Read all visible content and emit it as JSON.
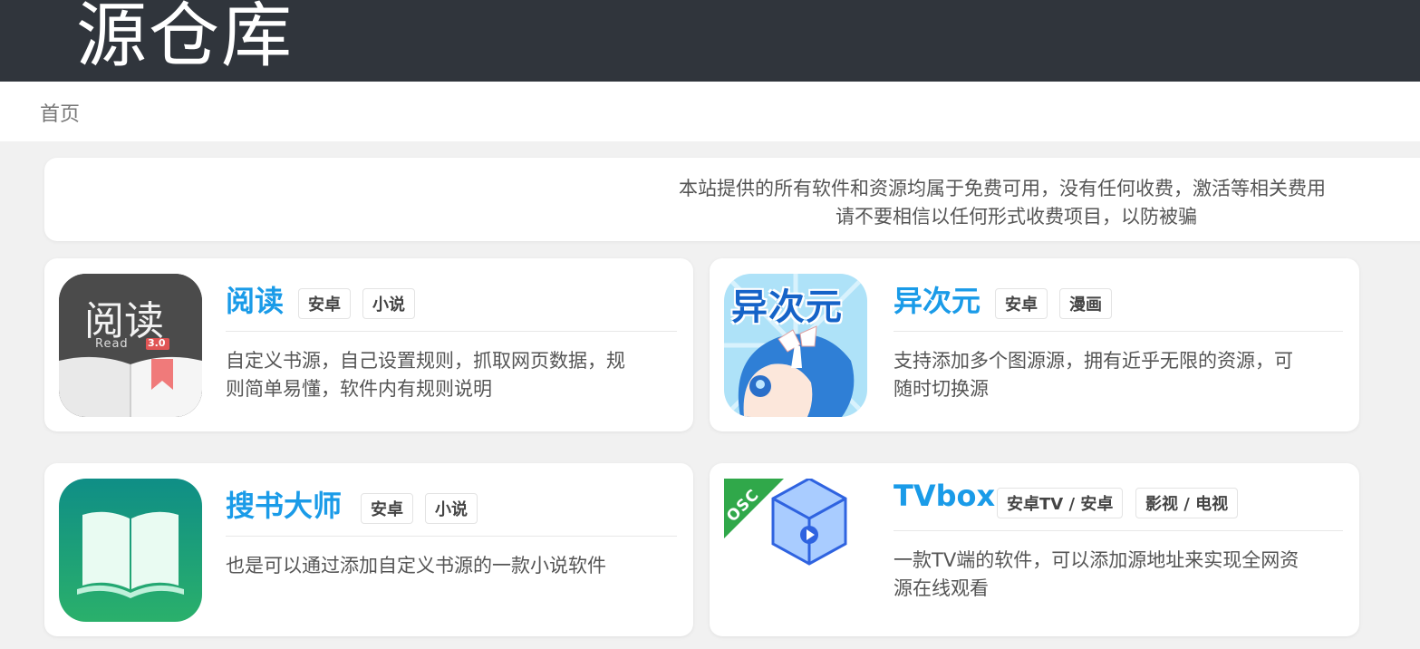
{
  "header": {
    "site_title": "源仓库"
  },
  "nav": {
    "home": "首页"
  },
  "notice": {
    "line1": "本站提供的所有软件和资源均属于免费可用，没有任何收费，激活等相关费用",
    "line2": "请不要相信以任何形式收费项目，以防被骗"
  },
  "cards": [
    {
      "title": "阅读",
      "tags": [
        "安卓",
        "小说"
      ],
      "desc_line1": "自定义书源，自己设置规则，抓取网页数据，规",
      "desc_line2": "则简单易懂，软件内有规则说明",
      "icon_text": "阅读",
      "icon_sub": "Read",
      "icon_version": "3.0"
    },
    {
      "title": "异次元",
      "tags": [
        "安卓",
        "漫画"
      ],
      "desc_line1": "支持添加多个图源源，拥有近乎无限的资源，可",
      "desc_line2": "随时切换源",
      "icon_text": "异次元"
    },
    {
      "title": "搜书大师",
      "tags": [
        "安卓",
        "小说"
      ],
      "desc_line1": "也是可以通过添加自定义书源的一款小说软件",
      "desc_line2": ""
    },
    {
      "title": "TVbox",
      "tags": [
        "安卓TV / 安卓",
        "影视 / 电视"
      ],
      "desc_line1": "一款TV端的软件，可以添加源地址来实现全网资",
      "desc_line2": "源在线观看",
      "icon_ribbon": "OSC"
    }
  ],
  "colors": {
    "header_bg": "#30353c",
    "title_blue": "#1a9be8",
    "page_bg": "#f1f1f1"
  }
}
